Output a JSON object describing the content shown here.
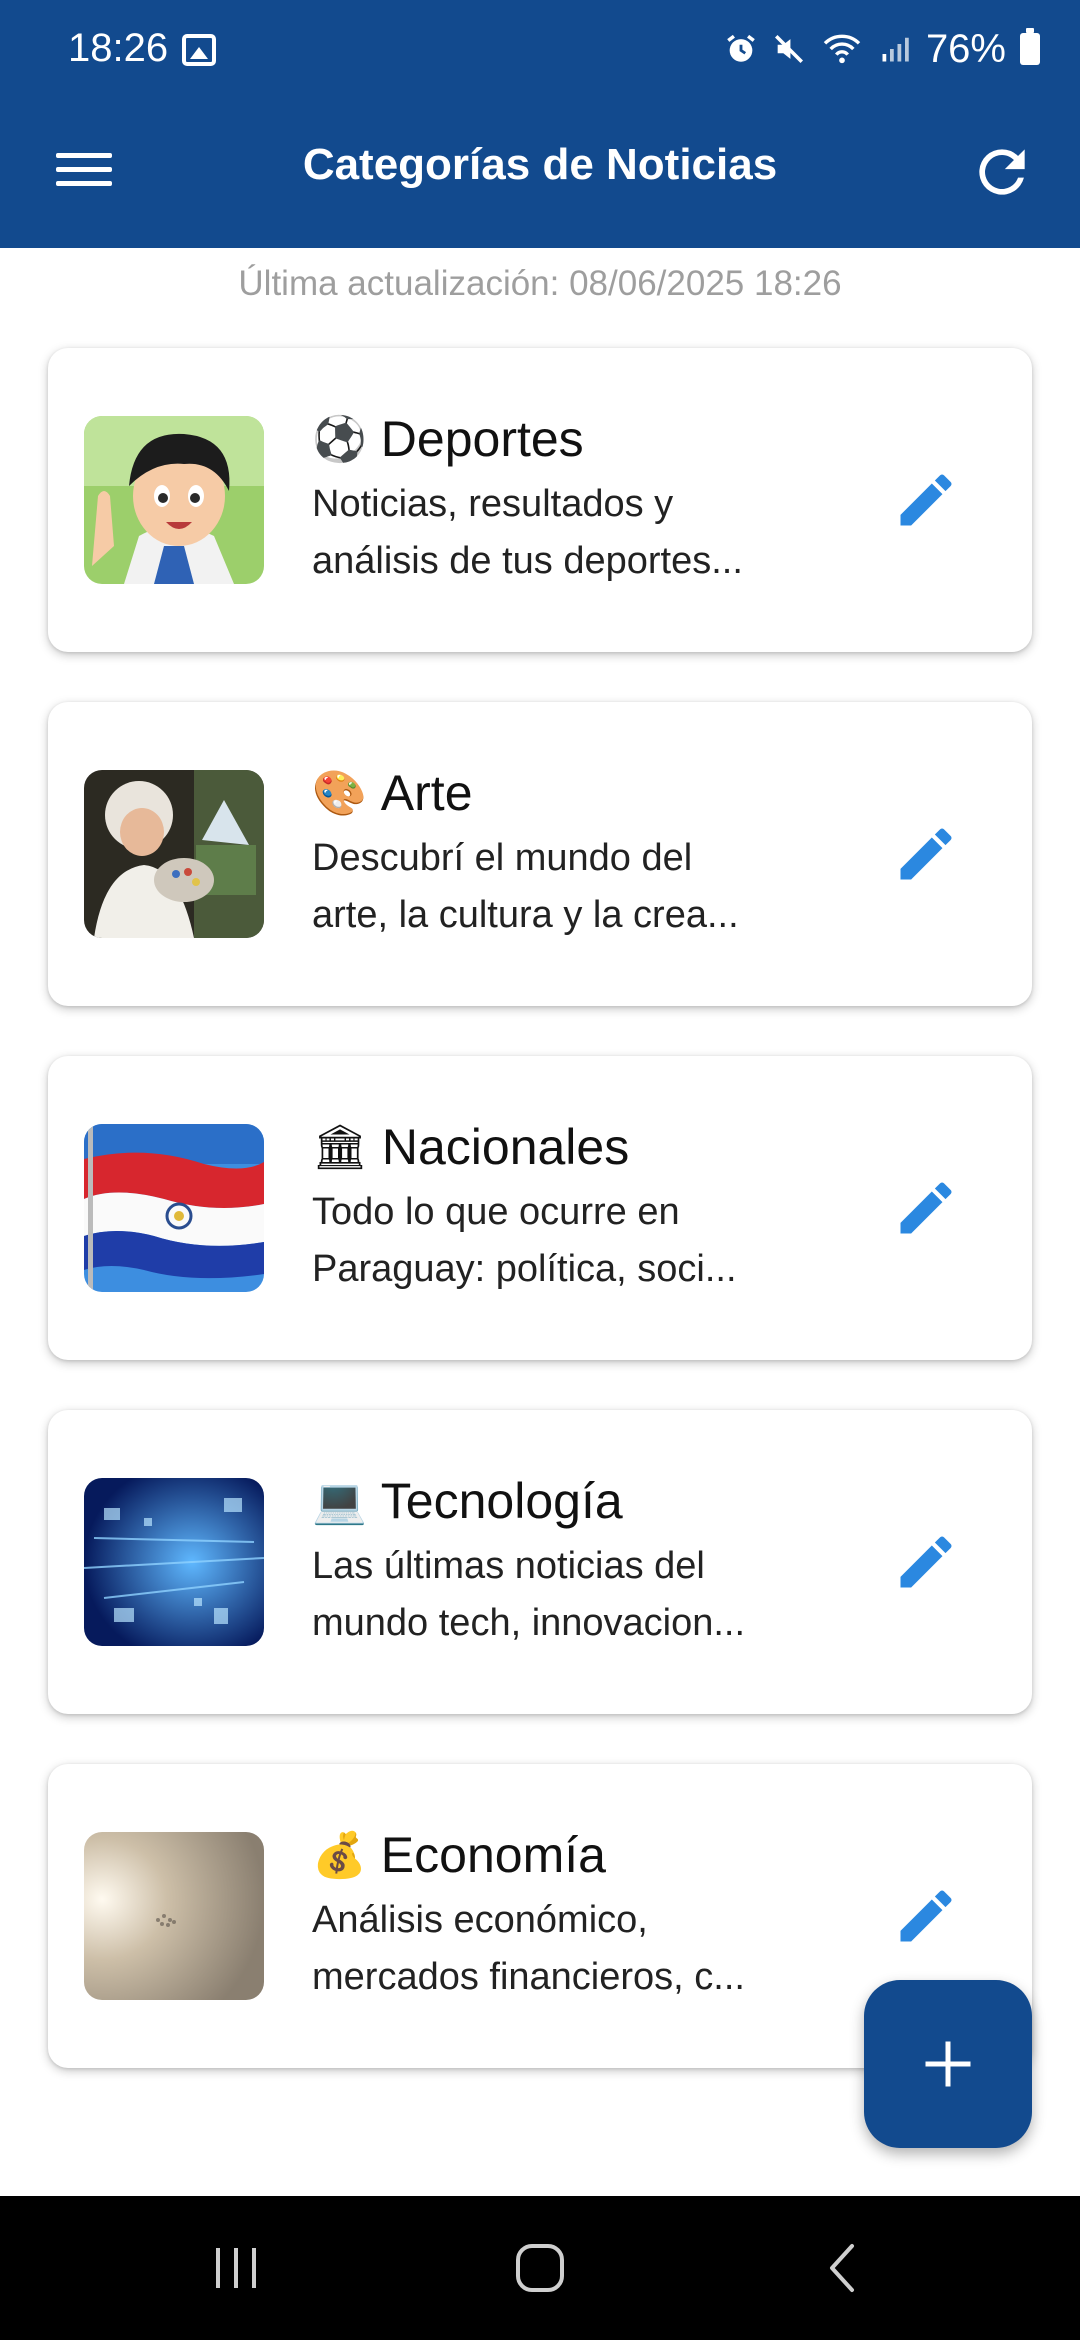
{
  "status_bar": {
    "time": "18:26",
    "battery": "76%",
    "icons": [
      "gallery-icon",
      "alarm-icon",
      "mute-icon",
      "wifi-icon",
      "signal-icon",
      "battery-icon"
    ]
  },
  "app_bar": {
    "title": "Categorías de Noticias",
    "menu_icon": "menu-icon",
    "refresh_icon": "refresh-icon"
  },
  "last_update": "Última actualización: 08/06/2025 18:26",
  "colors": {
    "primary": "#124a8e",
    "edit_icon": "#2b88e0",
    "muted_text": "#9e9e9e"
  },
  "categories": [
    {
      "emoji": "⚽",
      "name": "Deportes",
      "desc_line1": "Noticias, resultados y",
      "desc_line2": "análisis de tus deportes..."
    },
    {
      "emoji": "🎨",
      "name": "Arte",
      "desc_line1": "Descubrí el mundo del",
      "desc_line2": "arte, la cultura y la crea..."
    },
    {
      "emoji": "🏛",
      "name": "Nacionales",
      "desc_line1": "Todo lo que ocurre en",
      "desc_line2": "Paraguay: política, soci..."
    },
    {
      "emoji": "💻",
      "name": "Tecnología",
      "desc_line1": "Las últimas noticias del",
      "desc_line2": "mundo tech, innovacion..."
    },
    {
      "emoji": "💰",
      "name": "Economía",
      "desc_line1": "Análisis económico,",
      "desc_line2": "mercados financieros, c..."
    }
  ],
  "fab_icon": "plus-icon",
  "nav_bar": [
    "recent-apps-icon",
    "home-icon",
    "back-icon"
  ]
}
